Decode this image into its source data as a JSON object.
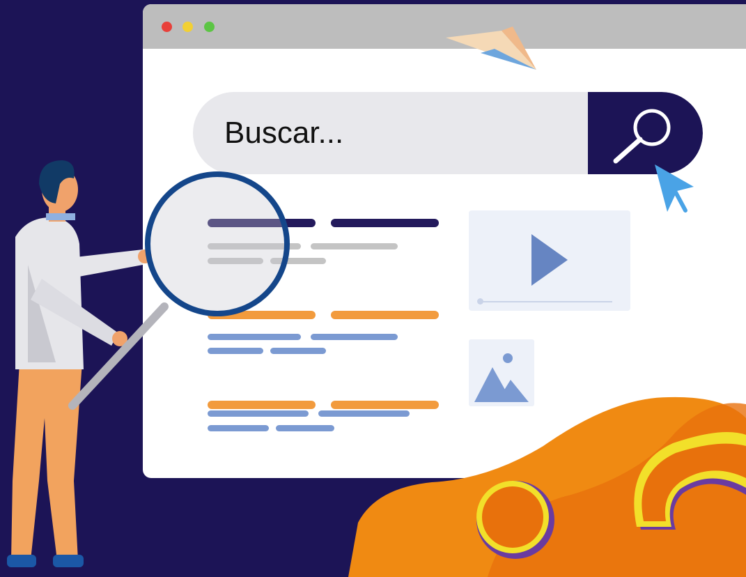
{
  "search": {
    "placeholder": "Buscar..."
  },
  "colors": {
    "background": "#1c1456",
    "accent_orange": "#f29b3d",
    "accent_blue": "#7b9ad2",
    "cursor_blue": "#4aa3e6",
    "question_yellow": "#f2e02a"
  },
  "icons": {
    "search": "magnifier-icon",
    "cursor": "pointer-cursor-icon",
    "play": "play-icon",
    "image": "image-icon",
    "plane": "paper-plane-icon"
  }
}
